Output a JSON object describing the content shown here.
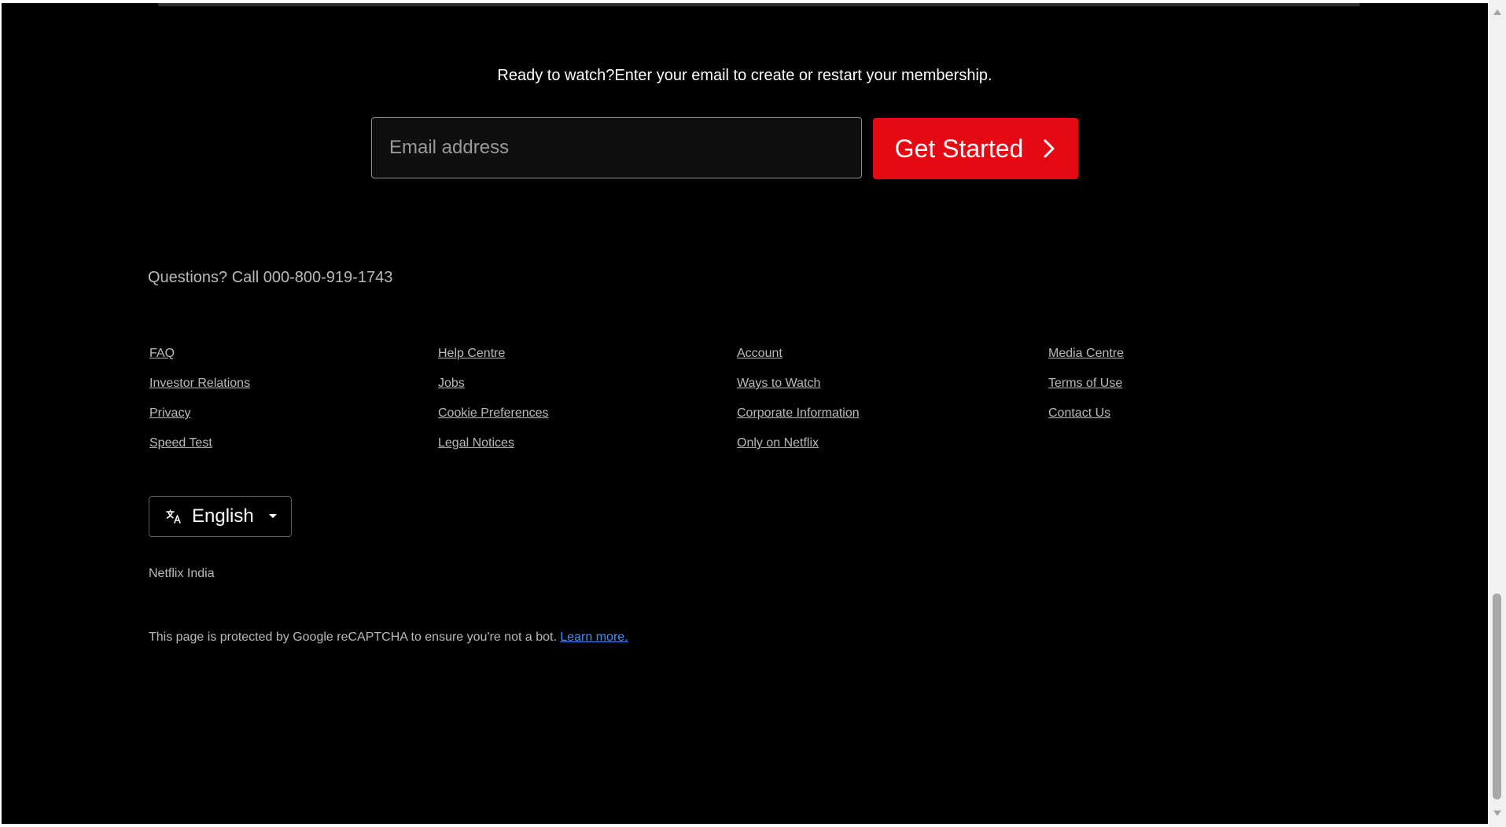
{
  "cta": {
    "heading": "Ready to watch?Enter your email to create or restart your membership.",
    "email_placeholder": "Email address",
    "button_label": "Get Started"
  },
  "footer": {
    "questions": "Questions? Call 000-800-919-1743",
    "columns": [
      [
        "FAQ",
        "Investor Relations",
        "Privacy",
        "Speed Test"
      ],
      [
        "Help Centre",
        "Jobs",
        "Cookie Preferences",
        "Legal Notices"
      ],
      [
        "Account",
        "Ways to Watch",
        "Corporate Information",
        "Only on Netflix"
      ],
      [
        "Media Centre",
        "Terms of Use",
        "Contact Us"
      ]
    ],
    "language": {
      "selected": "English",
      "icon": "translate-icon"
    },
    "country": "Netflix India",
    "recaptcha_text": "This page is protected by Google reCAPTCHA to ensure you're not a bot.",
    "recaptcha_link": "Learn more."
  },
  "colors": {
    "background": "#000000",
    "accent": "#e50914",
    "link_blue": "#448ef4"
  }
}
